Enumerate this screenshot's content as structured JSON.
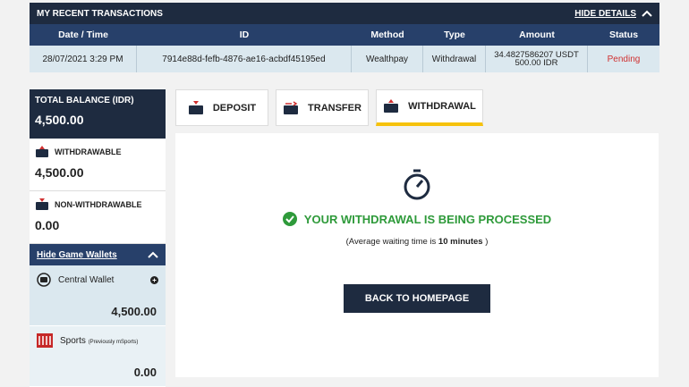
{
  "transactions": {
    "title": "MY RECENT TRANSACTIONS",
    "hide_label": "HIDE DETAILS",
    "columns": [
      "Date / Time",
      "ID",
      "Method",
      "Type",
      "Amount",
      "Status"
    ],
    "rows": [
      {
        "date": "28/07/2021 3:29 PM",
        "id": "7914e88d-fefb-4876-ae16-acbdf45195ed",
        "method": "Wealthpay",
        "type": "Withdrawal",
        "amount_usdt": "34.4827586207 USDT",
        "amount_idr": "500.00 IDR",
        "status": "Pending"
      }
    ]
  },
  "balance": {
    "total_label": "TOTAL BALANCE (IDR)",
    "total_value": "4,500.00",
    "withdrawable_label": "WITHDRAWABLE",
    "withdrawable_value": "4,500.00",
    "non_withdrawable_label": "NON-WITHDRAWABLE",
    "non_withdrawable_value": "0.00",
    "game_wallets_label": "Hide Game Wallets",
    "wallets": [
      {
        "name": "Central Wallet",
        "value": "4,500.00",
        "icon": "wallet-icon"
      },
      {
        "name": "Sports",
        "note": "(Previously mSports)",
        "value": "0.00",
        "icon": "sports-icon"
      }
    ]
  },
  "tabs": [
    {
      "label": "DEPOSIT",
      "active": false
    },
    {
      "label": "TRANSFER",
      "active": false
    },
    {
      "label": "WITHDRAWAL",
      "active": true
    }
  ],
  "content": {
    "status_text": "YOUR WITHDRAWAL IS BEING PROCESSED",
    "note_prefix": "(Average waiting time is ",
    "note_time": "10 minutes",
    "note_suffix": " )",
    "button_label": "BACK TO HOMEPAGE"
  },
  "colors": {
    "navy": "#1e2b40",
    "blue": "#27406a",
    "accent": "#f6c20c",
    "success": "#2e9a3a",
    "pending": "#d03030"
  }
}
